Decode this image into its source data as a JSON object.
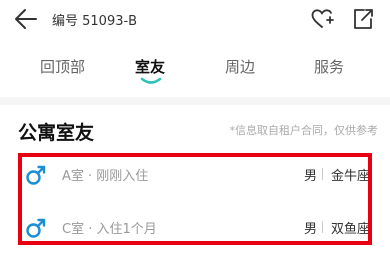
{
  "header": {
    "listing_no": "编号 51093-B",
    "back_icon": "arrow-left-icon",
    "favorite_icon": "heart-plus-icon",
    "share_icon": "share-icon"
  },
  "tabs": [
    {
      "label": "回顶部",
      "active": false
    },
    {
      "label": "室友",
      "active": true
    },
    {
      "label": "周边",
      "active": false
    },
    {
      "label": "服务",
      "active": false
    }
  ],
  "colors": {
    "accent": "#2fc3b6",
    "gender_icon": "#1a8fd6",
    "highlight": "#e60012"
  },
  "roommates_section": {
    "title": "公寓室友",
    "note": "*信息取自租户合同，仅供参考",
    "items": [
      {
        "desc": "A室 · 刚刚入住",
        "gender": "男",
        "sign": "金牛座"
      },
      {
        "desc": "C室 · 入住1个月",
        "gender": "男",
        "sign": "双鱼座"
      }
    ]
  }
}
